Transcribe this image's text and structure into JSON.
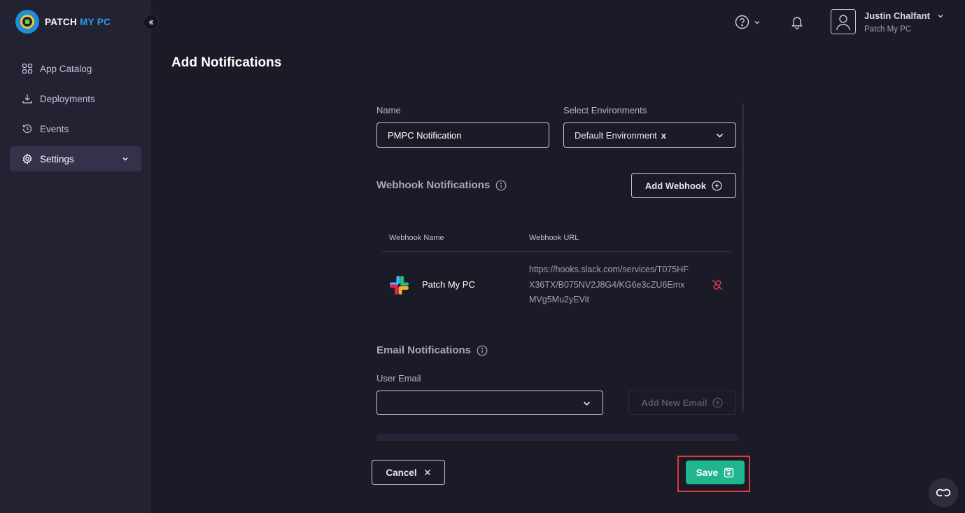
{
  "brand": {
    "name_part1": "PATCH ",
    "name_part2": "MY PC"
  },
  "sidebar": {
    "items": [
      {
        "label": "App Catalog",
        "icon": "grid-icon"
      },
      {
        "label": "Deployments",
        "icon": "download-icon"
      },
      {
        "label": "Events",
        "icon": "history-icon"
      },
      {
        "label": "Settings",
        "icon": "gear-icon"
      }
    ]
  },
  "header": {
    "user_name": "Justin Chalfant",
    "user_org": "Patch My PC"
  },
  "page": {
    "title": "Add Notifications"
  },
  "form": {
    "name_label": "Name",
    "name_value": "PMPC Notification",
    "env_label": "Select Environments",
    "env_selected": "Default Environment",
    "env_remove": "x",
    "webhook_title": "Webhook Notifications",
    "add_webhook_label": "Add Webhook",
    "table_headers": {
      "name": "Webhook Name",
      "url": "Webhook URL"
    },
    "webhooks": [
      {
        "name": "Patch My PC",
        "url": "https://hooks.slack.com/services/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"
      }
    ],
    "email_title": "Email Notifications",
    "user_email_label": "User Email",
    "user_email_value": "",
    "add_email_label": "Add New Email"
  },
  "footer": {
    "cancel_label": "Cancel",
    "save_label": "Save"
  },
  "colors": {
    "accent_green": "#20b48f",
    "highlight_red": "#e0393e",
    "brand_blue": "#2a9de4"
  }
}
